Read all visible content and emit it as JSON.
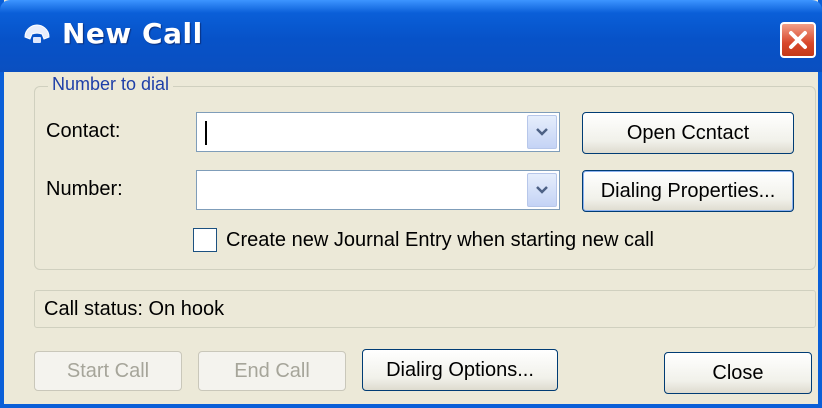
{
  "window": {
    "title": "New Call",
    "close_label": "Close window"
  },
  "number_group": {
    "legend": "Number to dial",
    "contact_label": "Contact:",
    "contact_value": "",
    "number_label": "Number:",
    "number_value": "",
    "open_contact_button": "Open Ccntact",
    "dialing_properties_button": "Dialing Properties...",
    "journal_checkbox_label": "Create new Journal Entry when starting new call",
    "journal_checked": false
  },
  "status": {
    "text": "Call status: On hook"
  },
  "footer": {
    "start_call_button": "Start Call",
    "end_call_button": "End Call",
    "dialing_options_button": "Dialirg Options...",
    "close_button": "Close"
  },
  "icons": {
    "title": "phone-icon",
    "close": "close-x-icon",
    "dropdown": "chevron-down-icon"
  },
  "colors": {
    "titlebar": "#0a5fd8",
    "window_bg": "#ece9d8",
    "close_button": "#d8472a",
    "legend_text": "#1e3fa8"
  }
}
